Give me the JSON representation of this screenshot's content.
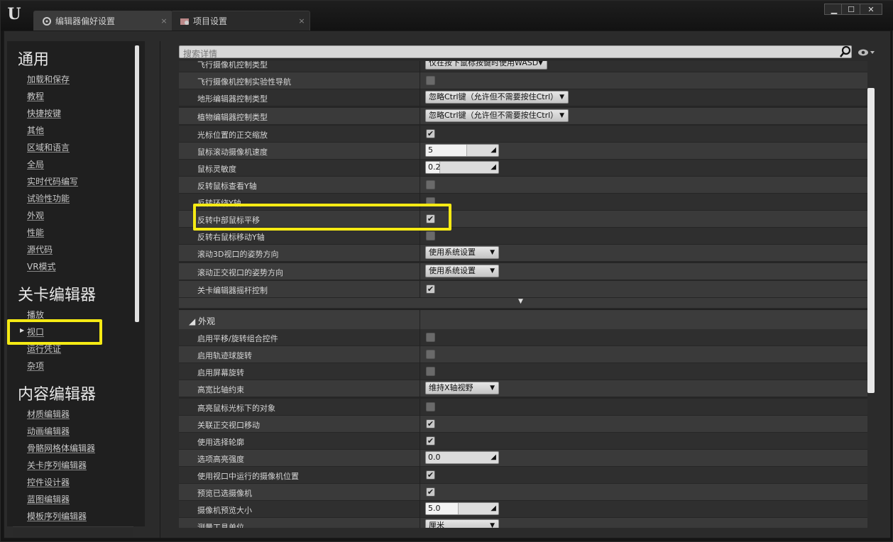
{
  "tabs": [
    {
      "label": "编辑器偏好设置",
      "close": "×"
    },
    {
      "label": "项目设置",
      "close": "×"
    }
  ],
  "window_buttons": [
    "▁",
    "☐",
    "✕"
  ],
  "search": {
    "placeholder": "搜索详情"
  },
  "sidebar": {
    "sections": [
      {
        "title": "通用",
        "items": [
          "加载和保存",
          "教程",
          "快捷按键",
          "其他",
          "区域和语言",
          "全局",
          "实时代码编写",
          "试验性功能",
          "外观",
          "性能",
          "源代码",
          "VR模式"
        ]
      },
      {
        "title": "关卡编辑器",
        "items": [
          "播放",
          "视口",
          "运行凭证",
          "杂项"
        ]
      },
      {
        "title": "内容编辑器",
        "items": [
          "材质编辑器",
          "动画编辑器",
          "骨骼网格体编辑器",
          "关卡序列编辑器",
          "控件设计器",
          "蓝图编辑器",
          "模板序列编辑器"
        ]
      }
    ],
    "selected": "视口"
  },
  "viewport_rows": [
    {
      "label": "飞行摄像机控制类型",
      "type": "dropdown",
      "value": "仅在按下鼠标按键时使用WASD"
    },
    {
      "label": "飞行摄像机控制实验性导航",
      "type": "checkbox",
      "checked": false
    },
    {
      "label": "地形编辑器控制类型",
      "type": "dropdown",
      "value": "忽略Ctrl键（允许但不需要按住Ctrl）"
    },
    {
      "label": "植物编辑器控制类型",
      "type": "dropdown",
      "value": "忽略Ctrl键（允许但不需要按住Ctrl）"
    },
    {
      "label": "光标位置的正交缩放",
      "type": "checkbox",
      "checked": true
    },
    {
      "label": "鼠标滚动摄像机速度",
      "type": "number",
      "value": "5",
      "fill": 0.5
    },
    {
      "label": "鼠标灵敏度",
      "type": "number",
      "value": "0.2",
      "fill": 0.2
    },
    {
      "label": "反转鼠标查看Y轴",
      "type": "checkbox",
      "checked": false
    },
    {
      "label": "反转环绕Y轴",
      "type": "checkbox",
      "checked": false
    },
    {
      "label": "反转中部鼠标平移",
      "type": "checkbox",
      "checked": true
    },
    {
      "label": "反转右鼠标移动Y轴",
      "type": "checkbox",
      "checked": false
    },
    {
      "label": "滚动3D视口的姿势方向",
      "type": "dropdown",
      "value": "使用系统设置"
    },
    {
      "label": "滚动正交视口的姿势方向",
      "type": "dropdown",
      "value": "使用系统设置"
    },
    {
      "label": "关卡编辑器摇杆控制",
      "type": "checkbox",
      "checked": true
    }
  ],
  "appearance": {
    "category": "外观",
    "rows": [
      {
        "label": "启用平移/旋转组合控件",
        "type": "checkbox",
        "checked": false
      },
      {
        "label": "启用轨迹球旋转",
        "type": "checkbox",
        "checked": false
      },
      {
        "label": "启用屏幕旋转",
        "type": "checkbox",
        "checked": false
      },
      {
        "label": "高宽比轴约束",
        "type": "dropdown",
        "value": "维持X轴视野"
      },
      {
        "label": "高亮鼠标光标下的对象",
        "type": "checkbox",
        "checked": false
      },
      {
        "label": "关联正交视口移动",
        "type": "checkbox",
        "checked": true
      },
      {
        "label": "使用选择轮廓",
        "type": "checkbox",
        "checked": true
      },
      {
        "label": "选项高亮强度",
        "type": "number",
        "value": "0.0",
        "fill": 0
      },
      {
        "label": "使用视口中运行的摄像机位置",
        "type": "checkbox",
        "checked": true
      },
      {
        "label": "预览已选摄像机",
        "type": "checkbox",
        "checked": true
      },
      {
        "label": "摄像机预览大小",
        "type": "number",
        "value": "5.0",
        "fill": 0.4
      },
      {
        "label": "测量工具单位",
        "type": "dropdown",
        "value": "厘米"
      }
    ]
  },
  "colors": {
    "highlight": "#f5ea14",
    "accent": "#3a3a3a"
  }
}
